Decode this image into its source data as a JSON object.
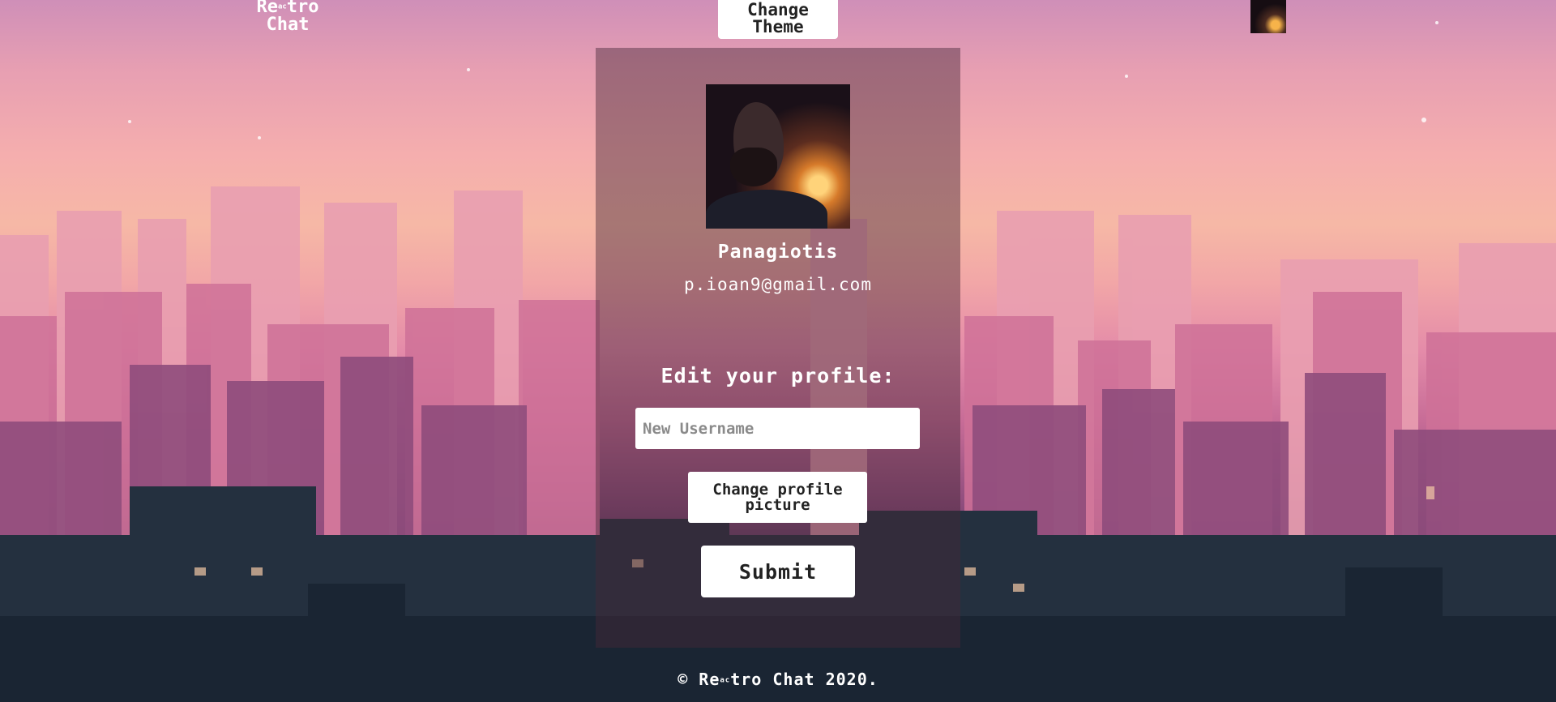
{
  "header": {
    "logo_main_1": "Re",
    "logo_sub": "ac",
    "logo_main_2": "tro",
    "logo_line2": "Chat",
    "theme_button_line1": "Change",
    "theme_button_line2": "Theme"
  },
  "profile": {
    "username": "Panagiotis",
    "email": "p.ioan9@gmail.com"
  },
  "edit": {
    "title": "Edit your profile:",
    "username_placeholder": "New Username",
    "change_picture_label": "Change profile picture",
    "submit_label": "Submit"
  },
  "footer": {
    "prefix": "© Re",
    "sub": "ac",
    "suffix": "tro Chat 2020."
  },
  "colors": {
    "sky_top": "#cf8fb8",
    "sky_mid": "#f6b8a6",
    "city_dark": "#1d2c3c",
    "button_bg": "#ffffff",
    "button_text": "#222222"
  },
  "icons": {
    "small_avatar": "user-avatar-icon"
  }
}
